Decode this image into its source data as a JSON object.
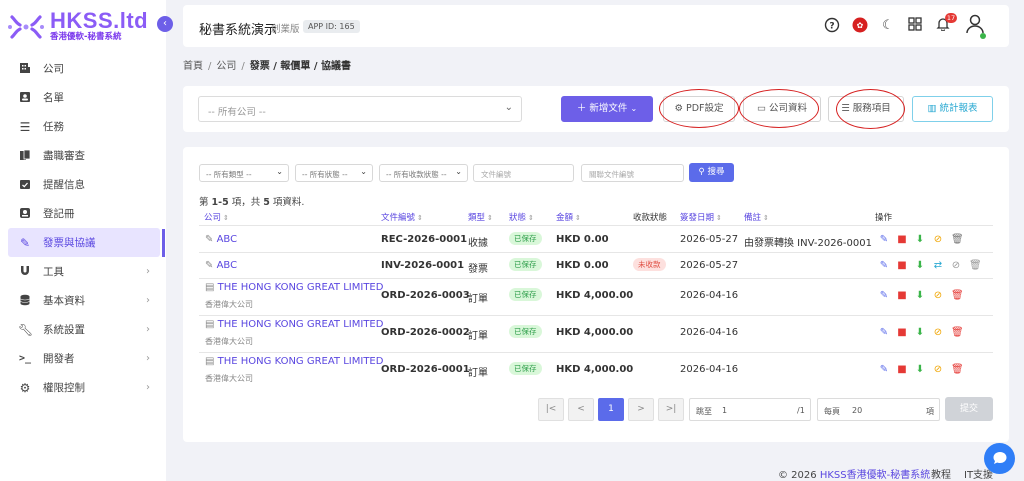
{
  "brand": {
    "name": "HKSS.ltd",
    "tagline": "香港優軟-秘書系統",
    "color": "#8b5cf6"
  },
  "sidebar": {
    "items": [
      {
        "label": "公司",
        "icon": "building-icon",
        "expandable": false
      },
      {
        "label": "名單",
        "icon": "contact-card-icon",
        "expandable": false
      },
      {
        "label": "任務",
        "icon": "checklist-icon",
        "expandable": false
      },
      {
        "label": "盡職審查",
        "icon": "documents-icon",
        "expandable": false
      },
      {
        "label": "提醒信息",
        "icon": "calendar-check-icon",
        "expandable": false
      },
      {
        "label": "登記冊",
        "icon": "register-icon",
        "expandable": false
      },
      {
        "label": "發票與協議",
        "icon": "pen-icon",
        "expandable": false,
        "active": true
      },
      {
        "label": "工具",
        "icon": "magnet-icon",
        "expandable": true
      },
      {
        "label": "基本資料",
        "icon": "database-icon",
        "expandable": true
      },
      {
        "label": "系統設置",
        "icon": "wrench-icon",
        "expandable": true
      },
      {
        "label": "開發者",
        "icon": "terminal-icon",
        "expandable": true
      },
      {
        "label": "權限控制",
        "icon": "cogs-icon",
        "expandable": true
      }
    ]
  },
  "topbar": {
    "title": "秘書系統演示",
    "edition": "創業版",
    "app_id": "APP ID: 165",
    "notification_count": "17"
  },
  "breadcrumb": {
    "home": "首頁",
    "company": "公司",
    "current": "發票 / 報價單 / 協議書"
  },
  "toolbar": {
    "company_placeholder": "-- 所有公司 --",
    "new_doc": "新增文件",
    "pdf_settings": "PDF設定",
    "company_info": "公司資料",
    "service_items": "服務項目",
    "stats_report": "統計報表"
  },
  "filters": {
    "type": "-- 所有類型 --",
    "status": "-- 所有狀態 --",
    "payment_status": "-- 所有收款狀態 --",
    "doc_no_placeholder": "文件編號",
    "related_doc_placeholder": "關聯文件編號",
    "search": "搜尋"
  },
  "summary": {
    "prefix": "第 ",
    "range": "1-5",
    "middle": " 項，共 ",
    "total": "5",
    "suffix": " 項資料."
  },
  "table": {
    "headers": {
      "company": "公司",
      "doc_no": "文件編號",
      "type": "類型",
      "status": "狀態",
      "amount": "金額",
      "payment_status": "收款狀態",
      "issue_date": "簽發日期",
      "remarks": "備註",
      "actions": "操作"
    },
    "rows": [
      {
        "company": "ABC",
        "company_sub": "",
        "doc_no": "REC-2026-0001",
        "type": "收據",
        "status": "已保存",
        "amount": "HKD 0.00",
        "payment_status": "",
        "date": "2026-05-27",
        "remarks": "由發票轉換 INV-2026-0001"
      },
      {
        "company": "ABC",
        "company_sub": "",
        "doc_no": "INV-2026-0001",
        "type": "發票",
        "status": "已保存",
        "amount": "HKD 0.00",
        "payment_status": "未收款",
        "date": "2026-05-27",
        "remarks": ""
      },
      {
        "company": "THE HONG KONG GREAT LIMITED",
        "company_sub": "香港偉大公司",
        "doc_no": "ORD-2026-0003",
        "type": "訂單",
        "status": "已保存",
        "amount": "HKD 4,000.00",
        "payment_status": "",
        "date": "2026-04-16",
        "remarks": ""
      },
      {
        "company": "THE HONG KONG GREAT LIMITED",
        "company_sub": "香港偉大公司",
        "doc_no": "ORD-2026-0002",
        "type": "訂單",
        "status": "已保存",
        "amount": "HKD 4,000.00",
        "payment_status": "",
        "date": "2026-04-16",
        "remarks": ""
      },
      {
        "company": "THE HONG KONG GREAT LIMITED",
        "company_sub": "香港偉大公司",
        "doc_no": "ORD-2026-0001",
        "type": "訂單",
        "status": "已保存",
        "amount": "HKD 4,000.00",
        "payment_status": "",
        "date": "2026-04-16",
        "remarks": ""
      }
    ]
  },
  "pagination": {
    "first": "|<",
    "prev": "<",
    "current": "1",
    "next": ">",
    "last": ">|",
    "goto_label": "跳至",
    "goto_value": "1",
    "total_pages": "/1",
    "per_page_label": "每頁",
    "per_page_value": "20",
    "items_label": "項",
    "submit": "提交"
  },
  "footer": {
    "copyright": "© 2026",
    "company": "HKSS香港優軟-秘書系統",
    "tutorial": "教程",
    "support": "IT支援"
  },
  "colors": {
    "primary": "#6d5fe8",
    "saved_badge": "#d9f7d9",
    "unpaid_badge": "#fde0de",
    "annotation_circle": "#d62020"
  }
}
